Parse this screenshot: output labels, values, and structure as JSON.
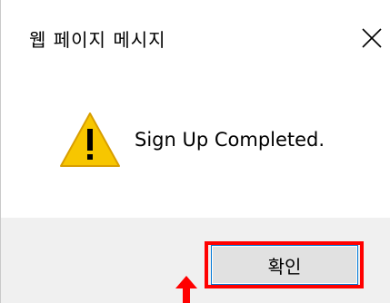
{
  "window": {
    "title": "웹 페이지 메시지",
    "close_icon": "close-x-icon"
  },
  "content": {
    "icon": "warning-triangle-icon",
    "message": "Sign Up Completed."
  },
  "footer": {
    "ok_label": "확인"
  },
  "annotations": {
    "highlight_color": "#ff0000",
    "arrow_icon": "red-arrow-up-icon",
    "arrow_color": "#ff0000"
  },
  "colors": {
    "warning_fill": "#f7c600",
    "warning_stroke": "#d89e00",
    "button_border": "#0078d7",
    "button_fill": "#e1e1e1",
    "footer_bg": "#f0f0f0"
  }
}
